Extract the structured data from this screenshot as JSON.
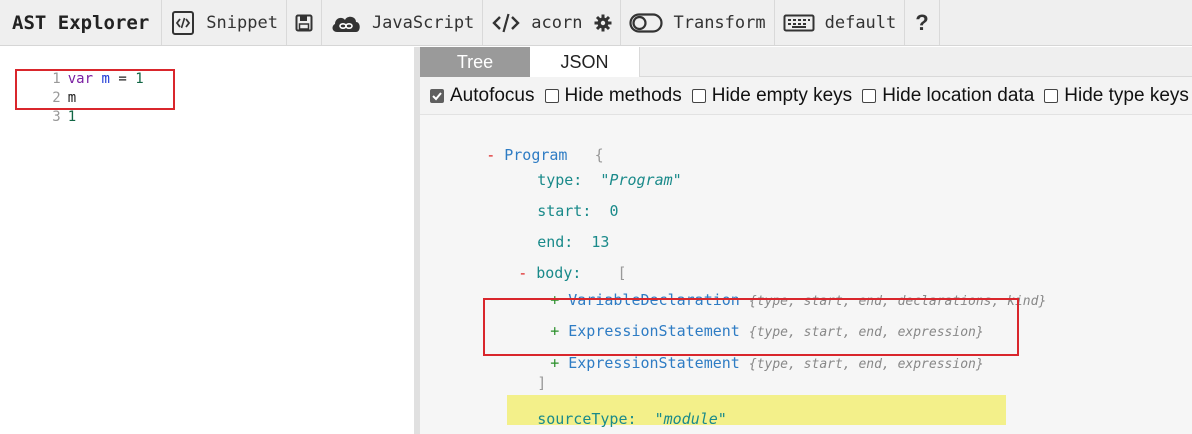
{
  "toolbar": {
    "title": "AST Explorer",
    "snippet_label": "Snippet",
    "language_label": "JavaScript",
    "parser_label": "acorn",
    "transform_label": "Transform",
    "keymap_label": "default",
    "help_label": "?"
  },
  "editor": {
    "lines": [
      {
        "num": "1",
        "tokens": [
          "var",
          "m",
          "=",
          "1"
        ]
      },
      {
        "num": "2",
        "text": "m"
      },
      {
        "num": "3",
        "text": "1"
      }
    ]
  },
  "tabs": {
    "tree": "Tree",
    "json": "JSON"
  },
  "options": {
    "autofocus": "Autofocus",
    "hide_methods": "Hide methods",
    "hide_empty_keys": "Hide empty keys",
    "hide_location_data": "Hide location data",
    "hide_type_keys": "Hide type keys"
  },
  "tree": {
    "root_toggle": "-",
    "root_name": "Program",
    "open_brace": "{",
    "type_key": "type:",
    "type_val": "\"Program\"",
    "start_key": "start:",
    "start_val": "0",
    "end_key": "end:",
    "end_val": "13",
    "body_toggle": "-",
    "body_key": "body:",
    "open_bracket": "[",
    "children": [
      {
        "toggle": "+",
        "name": "VariableDeclaration",
        "summary": "{type, start, end, declarations, kind}"
      },
      {
        "toggle": "+",
        "name": "ExpressionStatement",
        "summary": "{type, start, end, expression}"
      },
      {
        "toggle": "+",
        "name": "ExpressionStatement",
        "summary": "{type, start, end, expression}"
      }
    ],
    "close_bracket": "]",
    "sourcetype_key": "sourceType:",
    "sourcetype_val": "\"module\"",
    "close_brace": "}"
  },
  "colors": {
    "highlight": "#f3f08a",
    "annotation_box": "#d9262c",
    "active_tab": "#9a9a9a"
  }
}
